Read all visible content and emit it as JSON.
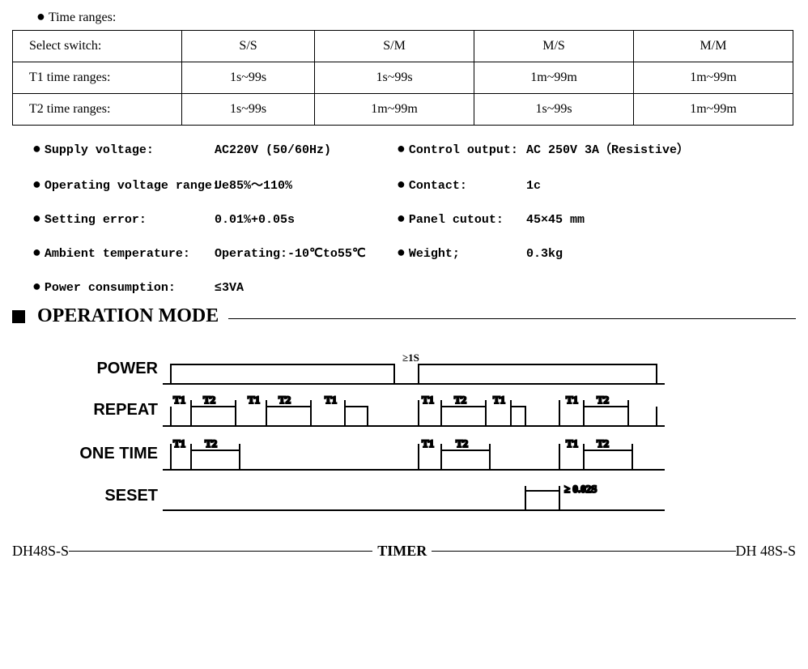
{
  "time_ranges_heading": "Time ranges:",
  "table": {
    "headers": [
      "Select switch:",
      "S/S",
      "S/M",
      "M/S",
      "M/M"
    ],
    "rows": [
      [
        "T1 time ranges:",
        "1s~99s",
        "1s~99s",
        "1m~99m",
        "1m~99m"
      ],
      [
        "T2 time ranges:",
        "1s~99s",
        "1m~99m",
        "1s~99s",
        "1m~99m"
      ]
    ]
  },
  "specs": {
    "supply_voltage_label": "Supply voltage:",
    "supply_voltage_value": "AC220V  (50/60Hz)",
    "control_output_label": "Control output:",
    "control_output_value": "AC 250V 3A（Resistive）",
    "op_voltage_range_label": "Operating voltage range:",
    "op_voltage_range_value": "Ue85%～110%",
    "contact_label": "Contact:",
    "contact_value": "1c",
    "setting_error_label": "Setting error:",
    "setting_error_value": "0.01%+0.05s",
    "panel_cutout_label": "Panel cutout:",
    "panel_cutout_value": "45×45 mm",
    "ambient_temp_label": "Ambient temperature:",
    "ambient_temp_value": "Operating:-10℃to55℃",
    "weight_label": "Weight;",
    "weight_value": "0.3kg",
    "power_consumption_label": "Power consumption:",
    "power_consumption_value": "≤3VA"
  },
  "operation_mode_heading": "OPERATION MODE",
  "timing": {
    "power": "POWER",
    "repeat": "REPEAT",
    "one_time": "ONE TIME",
    "seset": "SESET",
    "t1": "T1",
    "t2": "T2",
    "gte1s": "≥1S",
    "gte002s": "≥ 0.02S"
  },
  "footer": {
    "left": "DH48S-S",
    "center": "TIMER",
    "right": "DH 48S-S"
  }
}
